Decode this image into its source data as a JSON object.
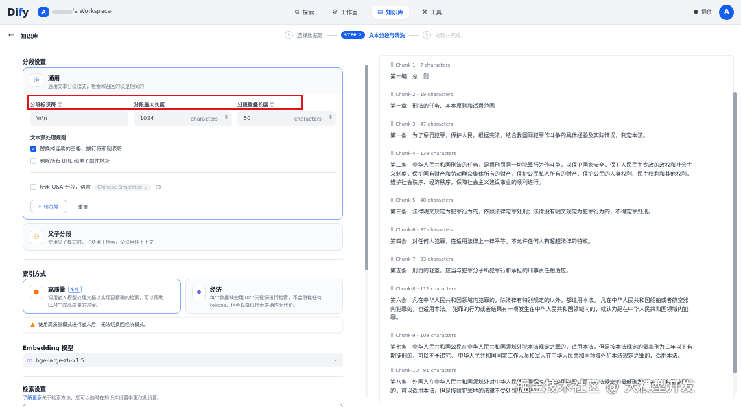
{
  "topbar": {
    "logo": "Dify",
    "workspace_initial": "A",
    "workspace_name": "'s Workspace",
    "nav": [
      {
        "label": "探索",
        "icon": "explore-icon"
      },
      {
        "label": "工作室",
        "icon": "studio-icon"
      },
      {
        "label": "知识库",
        "icon": "knowledge-icon",
        "active": true
      },
      {
        "label": "工具",
        "icon": "tools-icon"
      }
    ],
    "plugin_label": "插件",
    "user_initial": "A"
  },
  "subheader": {
    "title": "知识库",
    "steps": [
      {
        "num": "1",
        "label": "选择数据源"
      },
      {
        "pill": "STEP 2",
        "label": "文本分段与清洗"
      },
      {
        "num": "3",
        "label": "处理并完成"
      }
    ]
  },
  "segment": {
    "section_title": "分段设置",
    "general": {
      "title": "通用",
      "desc": "通用文本分块模式，检索和召回的块是相同的",
      "delimiter_label": "分段标识符",
      "max_len_label": "分段最大长度",
      "overlap_label": "分段重叠长度",
      "delimiter_value": "\\n\\n",
      "max_len_value": "1024",
      "overlap_value": "50",
      "unit": "characters",
      "preprocess_title": "文本预处理规则",
      "rule1": "替换掉连续的空格、换行符和制表符",
      "rule2": "删除所有 URL 和电子邮件地址",
      "qa_label": "使用 Q&A 分段，语言",
      "qa_lang": "Chinese Simplified",
      "preview_btn": "预览块",
      "reset_btn": "重置"
    },
    "parent_child": {
      "title": "父子分段",
      "desc": "使用父子模式时，子块用于检索，父块用作上下文"
    }
  },
  "index": {
    "section_title": "索引方式",
    "high": {
      "title": "高质量",
      "badge": "推荐",
      "desc1": "调用嵌入模型处理文档以实现更精确的检索，可以帮助",
      "desc2": "LLM生成高质量的答案。"
    },
    "eco": {
      "title": "经济",
      "desc1": "每个数据块使用10个关键词进行检索，不会消耗任何",
      "desc2": "tokens，但会以降低检索准确性为代价。"
    },
    "warning": "使用高质量模式进行嵌入后，无法切换回经济模式。"
  },
  "embedding": {
    "title": "Embedding 模型",
    "model": "bge-large-zh-v1.5"
  },
  "retrieval": {
    "title": "检索设置",
    "link": "了解更多",
    "desc": "关于检索方法，您可以随时在知识库设置中更改此设置。"
  },
  "chunks": [
    {
      "meta": "Chunk-1 · 7 characters",
      "lines": [
        "第一编　总　则"
      ]
    },
    {
      "meta": "Chunk-2 · 19 characters",
      "lines": [
        "第一章　刑法的任务、基本原则和适用范围"
      ]
    },
    {
      "meta": "Chunk-3 · 47 characters",
      "lines": [
        "第一条　为了惩罚犯罪，保护人民，根据宪法，结合我国同犯罪作斗争的具体经验及实际情况，制定本法。"
      ]
    },
    {
      "meta": "Chunk-4 · 138 characters",
      "lines": [
        "第二条　中华人民共和国刑法的任务，是用刑罚同一切犯罪行为作斗争，以保卫国家安全，保卫人民民主专政的政权和社会主",
        "义制度，保护国有财产和劳动群众集体所有的财产，保护公民私人所有的财产，保护公民的人身权利、民主权利和其他权利，",
        "维护社会秩序、经济秩序，保障社会主义建设事业的顺利进行。"
      ]
    },
    {
      "meta": "Chunk-5 · 48 characters",
      "lines": [
        "第三条　法律明文规定为犯罪行为的，依照法律定罪处刑；法律没有明文规定为犯罪行为的，不得定罪处刑。"
      ]
    },
    {
      "meta": "Chunk-6 · 37 characters",
      "lines": [
        "第四条　对任何人犯罪，在适用法律上一律平等。不允许任何人有超越法律的特权。"
      ]
    },
    {
      "meta": "Chunk-7 · 33 characters",
      "lines": [
        "第五条　刑罚的轻重，应当与犯罪分子所犯罪行和承担的刑事责任相适应。"
      ]
    },
    {
      "meta": "Chunk-8 · 112 characters",
      "lines": [
        "第六条　凡在中华人民共和国领域内犯罪的，除法律有特别规定的以外，都适用本法。 凡在中华人民共和国船舶或者航空器",
        "内犯罪的，也适用本法。 犯罪的行为或者结果有一项发生在中华人民共和国领域内的，就认为是在中华人民共和国领域内犯",
        "罪。"
      ]
    },
    {
      "meta": "Chunk-9 · 109 characters",
      "lines": [
        "第七条　中华人民共和国公民在中华人民共和国领域外犯本法规定之罪的，适用本法，但是按本法规定的最高刑为三年以下有",
        "期徒刑的，可以不予追究。 中华人民共和国国家工作人员和军人在中华人民共和国领域外犯本法规定之罪的，适用本法。"
      ]
    },
    {
      "meta": "Chunk-10 · 81 characters",
      "lines": [
        "第八条　外国人在中华人民共和国领域外对中华人民共和国国家或者公民犯罪，而按本法规定的最低刑为三年以上有期徒刑",
        "的，可以适用本法，但是按照犯罪地的法律不受处罚的除外。"
      ]
    }
  ],
  "watermark": "掘金技术社区 @ 大模型开发"
}
